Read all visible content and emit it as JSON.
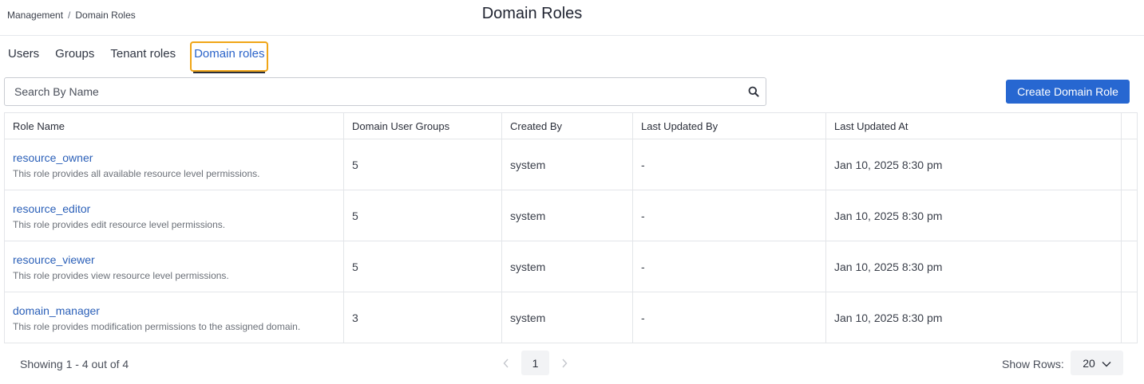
{
  "breadcrumb": {
    "parent": "Management",
    "separator": "/",
    "current": "Domain Roles"
  },
  "page_title": "Domain Roles",
  "tabs": [
    {
      "label": "Users",
      "active": false
    },
    {
      "label": "Groups",
      "active": false
    },
    {
      "label": "Tenant roles",
      "active": false
    },
    {
      "label": "Domain roles",
      "active": true
    }
  ],
  "search": {
    "placeholder": "Search By Name",
    "value": "",
    "icon": "search-icon"
  },
  "create_button": "Create Domain Role",
  "table": {
    "columns": [
      "Role Name",
      "Domain User Groups",
      "Created By",
      "Last Updated By",
      "Last Updated At"
    ],
    "rows": [
      {
        "name": "resource_owner",
        "description": "This role provides all available resource level permissions.",
        "groups": "5",
        "created_by": "system",
        "updated_by": "-",
        "updated_at": "Jan 10, 2025 8:30 pm"
      },
      {
        "name": "resource_editor",
        "description": "This role provides edit resource level permissions.",
        "groups": "5",
        "created_by": "system",
        "updated_by": "-",
        "updated_at": "Jan 10, 2025 8:30 pm"
      },
      {
        "name": "resource_viewer",
        "description": "This role provides view resource level permissions.",
        "groups": "5",
        "created_by": "system",
        "updated_by": "-",
        "updated_at": "Jan 10, 2025 8:30 pm"
      },
      {
        "name": "domain_manager",
        "description": "This role provides modification permissions to the assigned domain.",
        "groups": "3",
        "created_by": "system",
        "updated_by": "-",
        "updated_at": "Jan 10, 2025 8:30 pm"
      }
    ]
  },
  "footer": {
    "showing": "Showing 1 - 4 out of 4",
    "current_page": "1",
    "show_rows_label": "Show Rows:",
    "rows_per_page": "20"
  },
  "colors": {
    "accent": "#2767d1",
    "link": "#2a5fb8",
    "tab_focus": "#f0a516"
  }
}
